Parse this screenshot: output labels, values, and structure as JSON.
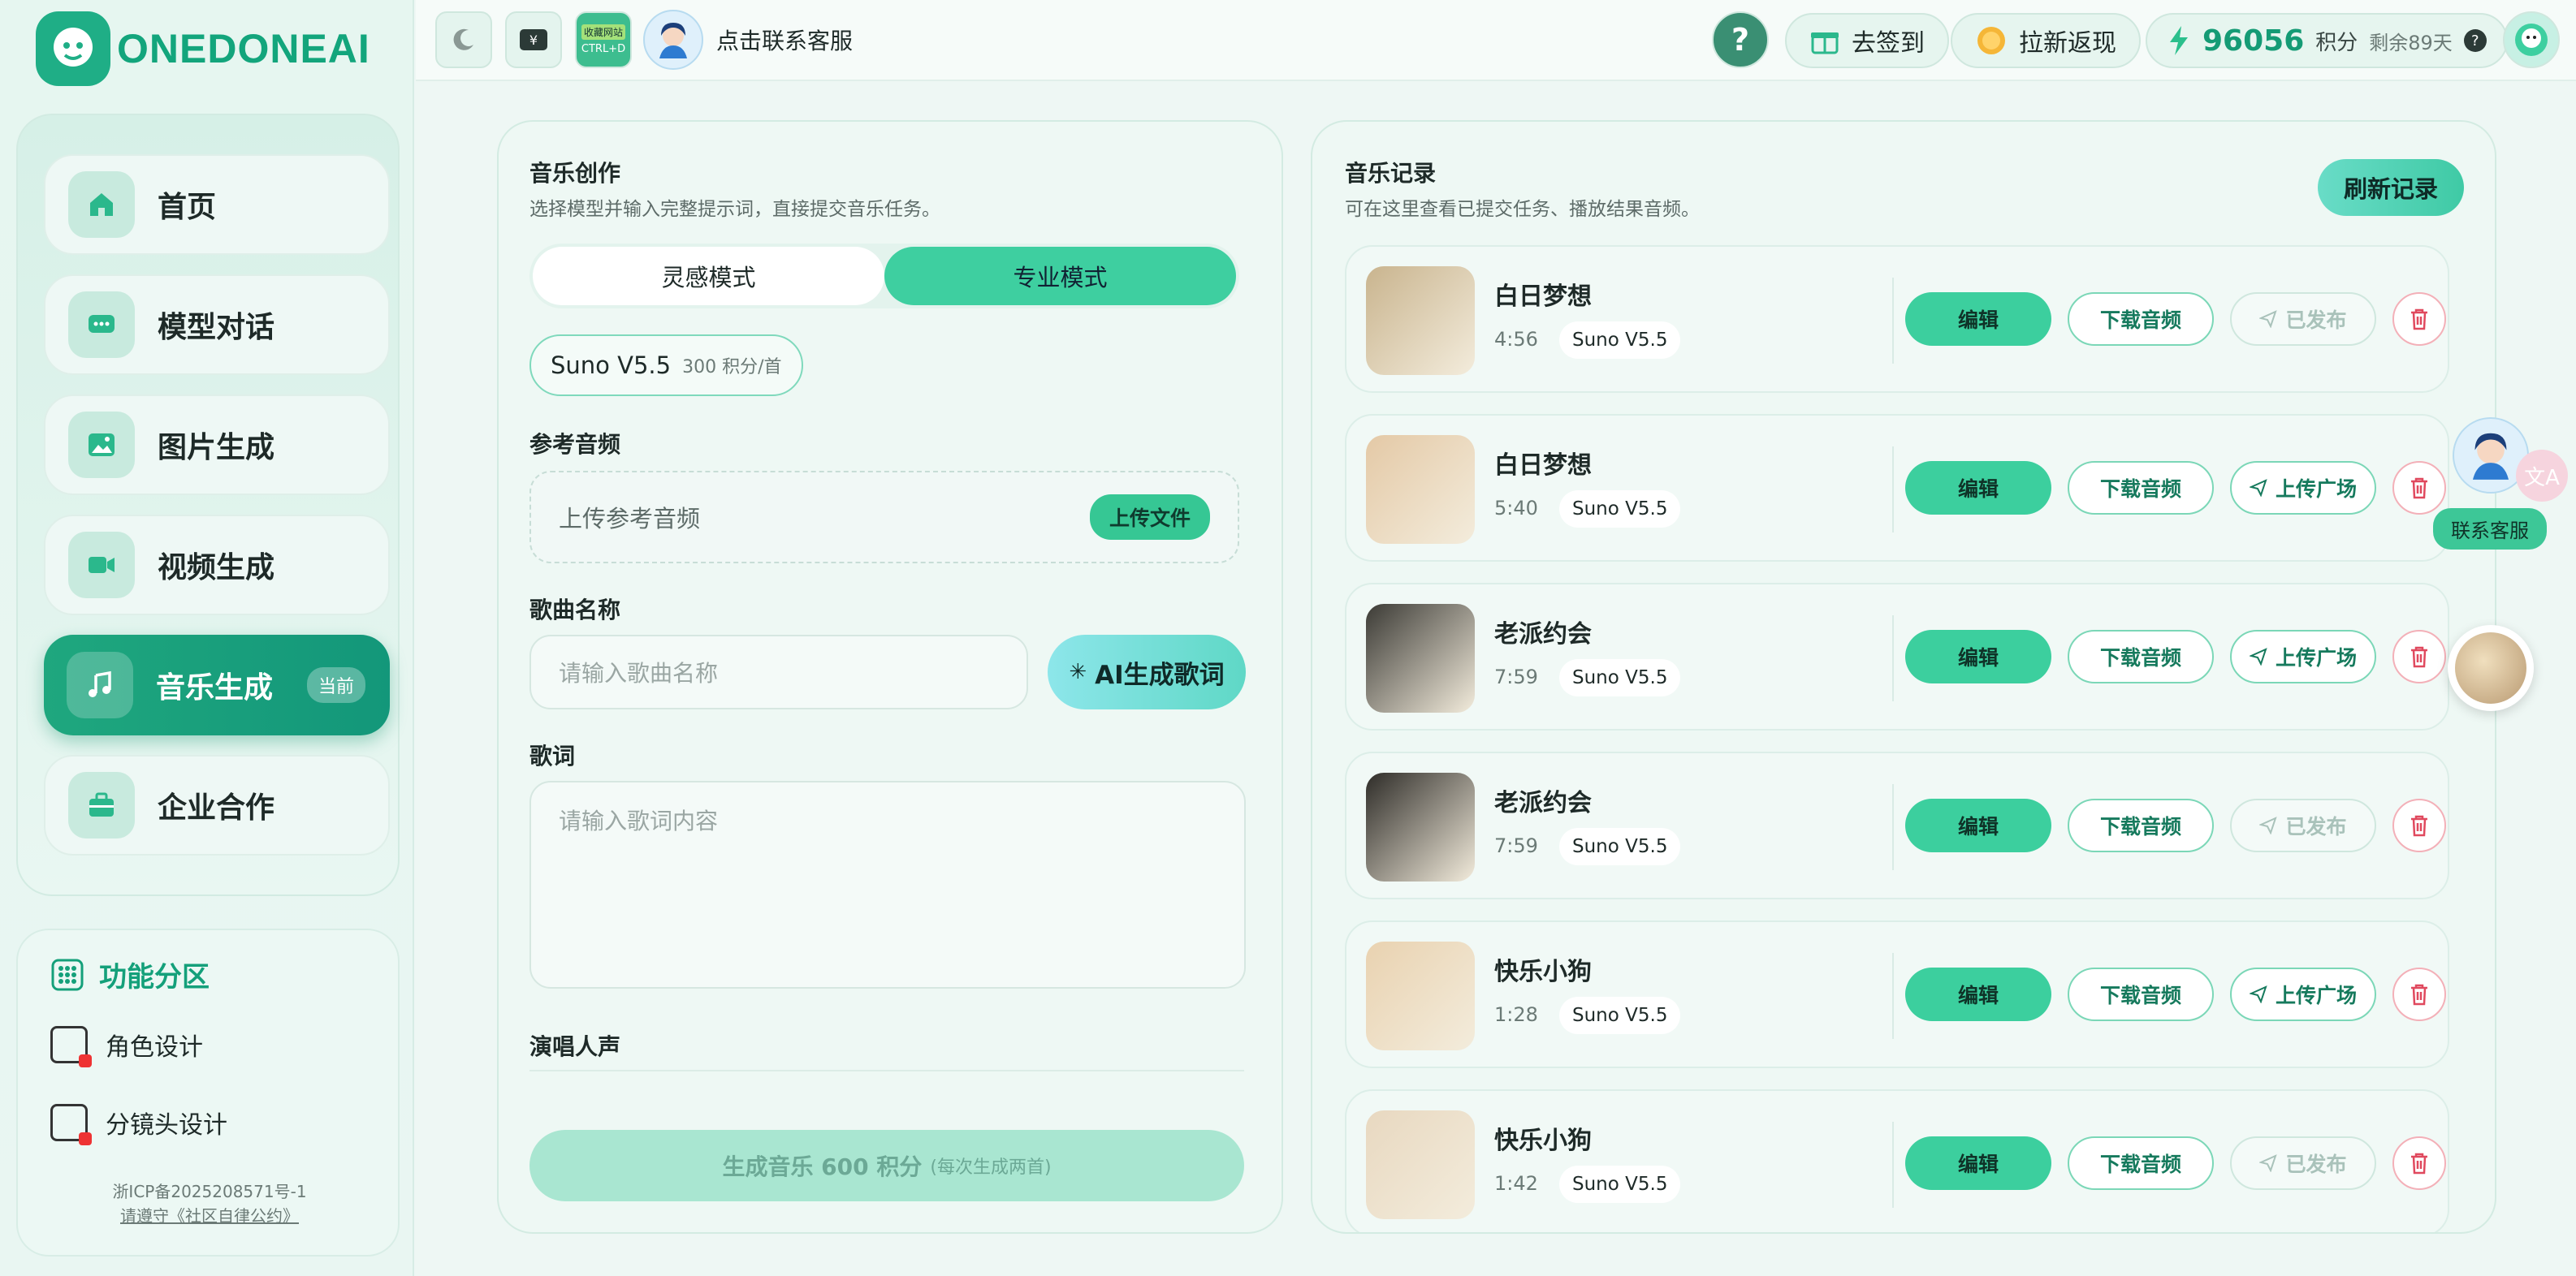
{
  "brand": {
    "name": "ONEDONEAI"
  },
  "sidebar": {
    "items": [
      {
        "label": "首页"
      },
      {
        "label": "模型对话"
      },
      {
        "label": "图片生成"
      },
      {
        "label": "视频生成"
      },
      {
        "label": "音乐生成",
        "badge": "当前"
      },
      {
        "label": "企业合作"
      }
    ],
    "functions": {
      "title": "功能分区",
      "items": [
        {
          "label": "角色设计"
        },
        {
          "label": "分镜头设计"
        }
      ]
    },
    "icp": "浙ICP备2025208571号-1",
    "community": "请遵守《社区自律公约》"
  },
  "topbar": {
    "bookmark_line1": "收藏网站",
    "bookmark_line2": "CTRL+D",
    "contact": "点击联系客服",
    "help": "?",
    "checkin": "去签到",
    "invite": "拉新返现",
    "points_value": "96056",
    "points_unit": "积分",
    "remaining": "剩余89天"
  },
  "creation": {
    "title": "音乐创作",
    "subtitle": "选择模型并输入完整提示词，直接提交音乐任务。",
    "modes": [
      {
        "label": "灵感模式"
      },
      {
        "label": "专业模式"
      }
    ],
    "model_name": "Suno V5.5",
    "model_cost": "300 积分/首",
    "ref_audio_label": "参考音频",
    "ref_audio_placeholder": "上传参考音频",
    "upload_button": "上传文件",
    "song_name_label": "歌曲名称",
    "song_name_placeholder": "请输入歌曲名称",
    "ai_lyrics_button": "AI生成歌词",
    "lyrics_label": "歌词",
    "lyrics_placeholder": "请输入歌词内容",
    "vocal_label": "演唱人声",
    "generate_button": "生成音乐 600 积分",
    "generate_note": "(每次生成两首)"
  },
  "records": {
    "title": "音乐记录",
    "subtitle": "可在这里查看已提交任务、播放结果音频。",
    "refresh_button": "刷新记录",
    "edit_label": "编辑",
    "download_label": "下载音频",
    "items": [
      {
        "title": "白日梦想",
        "duration": "4:56",
        "model": "Suno V5.5",
        "publish": "已发布",
        "published": true,
        "thumb": "#c9b48e"
      },
      {
        "title": "白日梦想",
        "duration": "5:40",
        "model": "Suno V5.5",
        "publish": "上传广场",
        "published": false,
        "thumb": "#e4c9a6"
      },
      {
        "title": "老派约会",
        "duration": "7:59",
        "model": "Suno V5.5",
        "publish": "上传广场",
        "published": false,
        "thumb": "#3b3a35"
      },
      {
        "title": "老派约会",
        "duration": "7:59",
        "model": "Suno V5.5",
        "publish": "已发布",
        "published": true,
        "thumb": "#2e2c28"
      },
      {
        "title": "快乐小狗",
        "duration": "1:28",
        "model": "Suno V5.5",
        "publish": "上传广场",
        "published": false,
        "thumb": "#e9d2b0"
      },
      {
        "title": "快乐小狗",
        "duration": "1:42",
        "model": "Suno V5.5",
        "publish": "已发布",
        "published": true,
        "thumb": "#e8d8c0"
      }
    ]
  },
  "float": {
    "contact": "联系客服"
  },
  "colors": {
    "accent": "#1fa77e",
    "mint": "#3ecfa0",
    "danger": "#e0495e"
  }
}
